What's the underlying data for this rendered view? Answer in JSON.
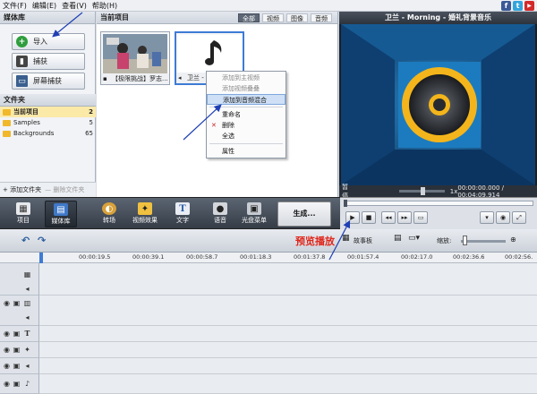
{
  "menu": [
    "文件(F)",
    "编辑(E)",
    "查看(V)",
    "帮助(H)"
  ],
  "social": [
    {
      "label": "f",
      "color": "#3b5998",
      "icon": "facebook-icon"
    },
    {
      "label": "t",
      "color": "#33a4dc",
      "icon": "twitter-icon"
    },
    {
      "label": "▶",
      "color": "#d32a2a",
      "icon": "youtube-icon"
    }
  ],
  "media_library": {
    "title": "媒体库",
    "import": "导入",
    "capture": "捕获",
    "screen_capture": "屏幕捕获"
  },
  "folders": {
    "title": "文件夹",
    "items": [
      {
        "name": "当前项目",
        "count": "2"
      },
      {
        "name": "Samples",
        "count": "5"
      },
      {
        "name": "Backgrounds",
        "count": "65"
      }
    ],
    "add_folder": "添加文件夹",
    "delete_folder": "删除文件夹"
  },
  "project": {
    "title": "当前项目",
    "tabs": [
      "全部",
      "视频",
      "图像",
      "音频"
    ],
    "clips": [
      {
        "caption": "【极限挑战】罗志..."
      },
      {
        "caption": "卫兰 - ..."
      }
    ]
  },
  "context_menu": {
    "items": [
      {
        "label": "添加到主视频",
        "state": "disabled"
      },
      {
        "label": "添加视频叠叠",
        "state": "disabled"
      },
      {
        "label": "添加到音频混合",
        "state": "highlighted"
      },
      {
        "label": "重命名",
        "state": "enabled"
      },
      {
        "label": "删除",
        "state": "enabled"
      },
      {
        "label": "全选",
        "state": "enabled"
      },
      {
        "label": "属性",
        "state": "enabled"
      }
    ]
  },
  "preview": {
    "title": "卫兰 - Morning - 婚礼背景音乐",
    "status": "暂停",
    "speed": "1x",
    "time": "00:00:00.000 / 00:04:09.914"
  },
  "toolbar": {
    "items": [
      "项目",
      "媒体库",
      "转场",
      "视频效果",
      "文字",
      "语音",
      "光盘菜单"
    ],
    "produce": "生成..."
  },
  "timeline": {
    "annotation": "预览播放",
    "storyboard": "故事板",
    "zoom": "缩放:",
    "ruler": [
      "00:00:19.5",
      "00:00:39.1",
      "00:00:58.7",
      "00:01:18.3",
      "00:01:37.8",
      "00:01:57.4",
      "00:02:17.0",
      "00:02:36.6",
      "00:02:56."
    ]
  }
}
